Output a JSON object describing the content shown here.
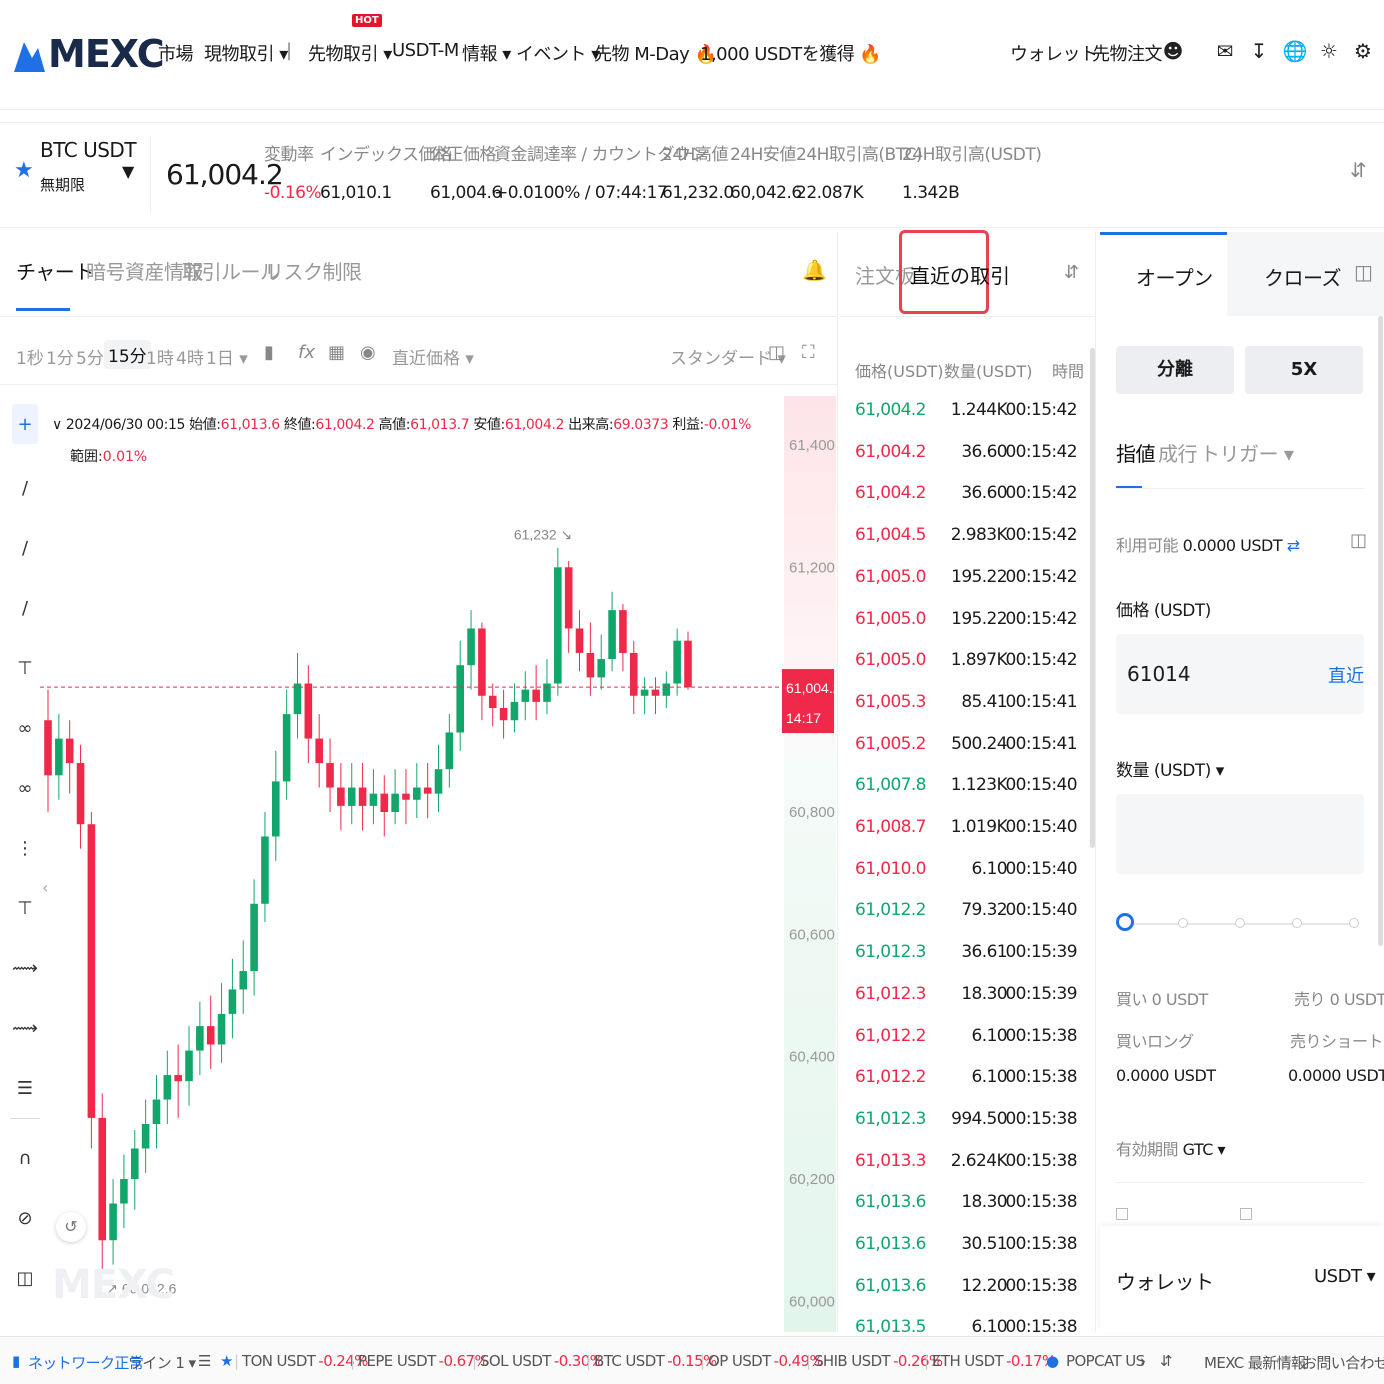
{
  "nav": {
    "logo": "MEXC",
    "items": [
      "市場",
      "現物取引 ▾",
      "|",
      "先物取引 ▾",
      "USDT-M",
      "情報 ▾",
      "イベント ▾",
      "先物 M-Day 🔥",
      "1,000 USDTを獲得 🔥"
    ],
    "hot_badge": "HOT",
    "right_items": [
      "ウォレット",
      "先物注文"
    ],
    "icons": [
      "user-icon",
      "chat-icon",
      "download-icon",
      "globe-icon",
      "sun-icon",
      "settings-icon"
    ]
  },
  "ticker": {
    "symbol": "BTC USDT",
    "contract": "無期限",
    "last_price": "61,004.2",
    "labels": [
      "変動率",
      "インデックス価格",
      "公正価格",
      "資金調達率 / カウントダウン",
      "24H高値",
      "24H安値",
      "24H取引高(BTC)",
      "24H取引高(USDT)"
    ],
    "values": [
      "-0.16%",
      "61,010.1",
      "61,004.6",
      "+0.0100% / 07:44:17",
      "61,232.0",
      "60,042.6",
      "22.087K",
      "1.342B"
    ]
  },
  "chart_tabs": [
    "チャート",
    "暗号資産情報",
    "取引ルール",
    "リスク制限"
  ],
  "timeframes": [
    "1秒",
    "1分",
    "5分",
    "15分",
    "1時",
    "4時",
    "1日 ▾"
  ],
  "active_timeframe": "15分",
  "chart_toolbar": {
    "price_type": "直近価格 ▾",
    "view": "スタンダード ▾"
  },
  "ohlc": {
    "date": "2024/06/30 00:15",
    "open_label": "始値:",
    "open": "61,013.6",
    "close_label": "終値:",
    "close": "61,004.2",
    "high_label": "高値:",
    "high": "61,013.7",
    "low_label": "安値:",
    "low": "61,004.2",
    "vol_label": "出来高:",
    "vol": "69.0373",
    "pnl_label": "利益:",
    "pnl": "-0.01%",
    "range_label": "範囲:",
    "range": "0.01%"
  },
  "chart_data": {
    "type": "candlestick",
    "y_ticks": [
      "61,400",
      "61,200",
      "60,800",
      "60,600",
      "60,400",
      "60,200",
      "60,000"
    ],
    "ylim": [
      59950,
      61480
    ],
    "high_marker": "61,232",
    "low_marker": "60,042.6",
    "current_price": "61,004.2",
    "current_countdown": "14:17",
    "candles": [
      [
        60950,
        60860,
        61000,
        60800
      ],
      [
        60860,
        60920,
        60960,
        60820
      ],
      [
        60920,
        60880,
        60950,
        60830
      ],
      [
        60880,
        60780,
        60910,
        60740
      ],
      [
        60780,
        60300,
        60800,
        60250
      ],
      [
        60300,
        60100,
        60340,
        60050
      ],
      [
        60100,
        60160,
        60200,
        60060
      ],
      [
        60160,
        60200,
        60240,
        60120
      ],
      [
        60200,
        60250,
        60280,
        60150
      ],
      [
        60250,
        60290,
        60330,
        60210
      ],
      [
        60290,
        60330,
        60370,
        60250
      ],
      [
        60330,
        60370,
        60410,
        60290
      ],
      [
        60370,
        60360,
        60420,
        60300
      ],
      [
        60360,
        60410,
        60450,
        60320
      ],
      [
        60410,
        60450,
        60490,
        60370
      ],
      [
        60450,
        60420,
        60500,
        60380
      ],
      [
        60420,
        60470,
        60520,
        60390
      ],
      [
        60470,
        60510,
        60560,
        60430
      ],
      [
        60510,
        60540,
        60590,
        60470
      ],
      [
        60540,
        60650,
        60690,
        60500
      ],
      [
        60650,
        60760,
        60800,
        60620
      ],
      [
        60760,
        60850,
        60900,
        60720
      ],
      [
        60850,
        60960,
        61000,
        60820
      ],
      [
        60960,
        61010,
        61060,
        60920
      ],
      [
        61010,
        60920,
        61040,
        60880
      ],
      [
        60920,
        60880,
        60960,
        60840
      ],
      [
        60880,
        60840,
        60920,
        60800
      ],
      [
        60840,
        60810,
        60880,
        60770
      ],
      [
        60810,
        60840,
        60880,
        60780
      ],
      [
        60840,
        60810,
        60880,
        60770
      ],
      [
        60810,
        60830,
        60870,
        60780
      ],
      [
        60830,
        60800,
        60860,
        60760
      ],
      [
        60800,
        60830,
        60870,
        60780
      ],
      [
        60830,
        60820,
        60870,
        60780
      ],
      [
        60820,
        60840,
        60880,
        60790
      ],
      [
        60840,
        60830,
        60880,
        60790
      ],
      [
        60830,
        60870,
        60910,
        60800
      ],
      [
        60870,
        60930,
        60960,
        60840
      ],
      [
        60930,
        61040,
        61080,
        60900
      ],
      [
        61040,
        61100,
        61130,
        61000
      ],
      [
        61100,
        60990,
        61110,
        60950
      ],
      [
        60990,
        60970,
        61010,
        60940
      ],
      [
        60970,
        60950,
        61000,
        60920
      ],
      [
        60950,
        60980,
        61010,
        60930
      ],
      [
        60980,
        61000,
        61030,
        60950
      ],
      [
        61000,
        60980,
        61040,
        60950
      ],
      [
        60980,
        61010,
        61050,
        60960
      ],
      [
        61010,
        61200,
        61232,
        60990
      ],
      [
        61200,
        61100,
        61210,
        61060
      ],
      [
        61100,
        61060,
        61130,
        61030
      ],
      [
        61060,
        61020,
        61110,
        60990
      ],
      [
        61020,
        61050,
        61090,
        61000
      ],
      [
        61050,
        61130,
        61160,
        61030
      ],
      [
        61130,
        61060,
        61140,
        61030
      ],
      [
        61060,
        60990,
        61080,
        60960
      ],
      [
        60990,
        61000,
        61020,
        60960
      ],
      [
        61000,
        60990,
        61020,
        60960
      ],
      [
        60990,
        61010,
        61030,
        60970
      ],
      [
        61010,
        61080,
        61100,
        60990
      ],
      [
        61080,
        61004,
        61095,
        61000
      ]
    ]
  },
  "trades": {
    "tabs": [
      "注文板",
      "直近の取引"
    ],
    "headers": [
      "価格(USDT)",
      "数量(USDT)",
      "時間"
    ],
    "rows": [
      [
        "61,004.2",
        "1.244K",
        "00:15:42",
        "g"
      ],
      [
        "61,004.2",
        "36.60",
        "00:15:42",
        "r"
      ],
      [
        "61,004.2",
        "36.60",
        "00:15:42",
        "r"
      ],
      [
        "61,004.5",
        "2.983K",
        "00:15:42",
        "r"
      ],
      [
        "61,005.0",
        "195.22",
        "00:15:42",
        "r"
      ],
      [
        "61,005.0",
        "195.22",
        "00:15:42",
        "r"
      ],
      [
        "61,005.0",
        "1.897K",
        "00:15:42",
        "r"
      ],
      [
        "61,005.3",
        "85.41",
        "00:15:41",
        "r"
      ],
      [
        "61,005.2",
        "500.24",
        "00:15:41",
        "r"
      ],
      [
        "61,007.8",
        "1.123K",
        "00:15:40",
        "g"
      ],
      [
        "61,008.7",
        "1.019K",
        "00:15:40",
        "r"
      ],
      [
        "61,010.0",
        "6.10",
        "00:15:40",
        "r"
      ],
      [
        "61,012.2",
        "79.32",
        "00:15:40",
        "g"
      ],
      [
        "61,012.3",
        "36.61",
        "00:15:39",
        "g"
      ],
      [
        "61,012.3",
        "18.30",
        "00:15:39",
        "r"
      ],
      [
        "61,012.2",
        "6.10",
        "00:15:38",
        "r"
      ],
      [
        "61,012.2",
        "6.10",
        "00:15:38",
        "r"
      ],
      [
        "61,012.3",
        "994.50",
        "00:15:38",
        "g"
      ],
      [
        "61,013.3",
        "2.624K",
        "00:15:38",
        "r"
      ],
      [
        "61,013.6",
        "18.30",
        "00:15:38",
        "g"
      ],
      [
        "61,013.6",
        "30.51",
        "00:15:38",
        "g"
      ],
      [
        "61,013.6",
        "12.20",
        "00:15:38",
        "g"
      ],
      [
        "61,013.5",
        "6.10",
        "00:15:38",
        "g"
      ]
    ]
  },
  "order": {
    "tabs": [
      "オープン",
      "クローズ"
    ],
    "margin_mode": "分離",
    "leverage": "5X",
    "order_types": [
      "指値",
      "成行",
      "トリガー ▾"
    ],
    "available_label": "利用可能",
    "available": "0.0000 USDT",
    "price_label": "価格 (USDT)",
    "price_value": "61014",
    "price_last": "直近",
    "qty_label": "数量 (USDT) ▾",
    "qty_value": "",
    "buy_label": "買い 0 USDT",
    "sell_label": "売り 0 USDT",
    "long_label": "買いロング",
    "short_label": "売りショート",
    "long_value": "0.0000 USDT",
    "short_value": "0.0000 USDT",
    "validity_label": "有効期間",
    "validity": "GTC ▾",
    "wallet_label": "ウォレット",
    "wallet_ccy": "USDT ▾"
  },
  "footer": {
    "network": "ネットワーク正常",
    "line": "ライン 1 ▾",
    "tickers": [
      {
        "name": "TON USDT",
        "chg": "-0.24%"
      },
      {
        "name": "PEPE USDT",
        "chg": "-0.67%"
      },
      {
        "name": "SOL USDT",
        "chg": "-0.30%"
      },
      {
        "name": "BTC USDT",
        "chg": "-0.15%"
      },
      {
        "name": "OP USDT",
        "chg": "-0.49%"
      },
      {
        "name": "SHIB USDT",
        "chg": "-0.26%"
      },
      {
        "name": "ETH USDT",
        "chg": "-0.17%"
      }
    ],
    "popcat": "POPCAT US",
    "news": "MEXC 最新情報",
    "contact": "お問い合わせ"
  },
  "colors": {
    "up": "#12a66b",
    "down": "#f0294a",
    "accent": "#1f6fe5",
    "highlight_border": "#e8414f"
  }
}
